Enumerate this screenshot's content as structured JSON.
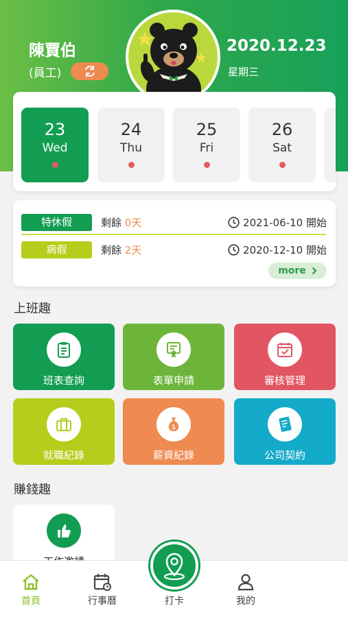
{
  "colors": {
    "brand_green": "#129d52",
    "header_gradient": [
      "#6cbf45",
      "#17a15a"
    ],
    "accent_orange": "#ef8a50",
    "dot_red": "#e35a63",
    "lime": "#b6cd1b",
    "nav_active": "#8cbf24"
  },
  "header": {
    "user_name": "陳賈伯",
    "user_role": "(員工)",
    "switch_icon": "swap-icon",
    "date": "2020.12.23",
    "weekday": "星期三",
    "avatar": "bear-mascot-avatar"
  },
  "date_strip": {
    "days": [
      {
        "num": "23",
        "dow": "Wed",
        "active": true
      },
      {
        "num": "24",
        "dow": "Thu",
        "active": false
      },
      {
        "num": "25",
        "dow": "Fri",
        "active": false
      },
      {
        "num": "26",
        "dow": "Sat",
        "active": false
      }
    ]
  },
  "leave": {
    "items": [
      {
        "type": "特休假",
        "remain_label": "剩餘",
        "remain_value": "0天",
        "date": "2021-06-10 開始",
        "color": "#129d52"
      },
      {
        "type": "病假",
        "remain_label": "剩餘",
        "remain_value": "2天",
        "date": "2020-12-10 開始",
        "color": "#b6cd1b"
      }
    ],
    "more_label": "more"
  },
  "work_section": {
    "title": "上班趣",
    "tiles": [
      {
        "label": "班表查詢",
        "icon": "clipboard-icon",
        "color": "#129d52"
      },
      {
        "label": "表單申請",
        "icon": "certificate-icon",
        "color": "#6db53a"
      },
      {
        "label": "審核管理",
        "icon": "calendar-check-icon",
        "color": "#e25562"
      },
      {
        "label": "就職紀錄",
        "icon": "briefcase-icon",
        "color": "#b6cd1b"
      },
      {
        "label": "薪資紀錄",
        "icon": "money-bag-icon",
        "color": "#ef8a50"
      },
      {
        "label": "公司契約",
        "icon": "contract-icon",
        "color": "#14aac9"
      }
    ]
  },
  "earn_section": {
    "title": "賺錢趣",
    "tiles": [
      {
        "label": "工作邀請",
        "icon": "thumbs-up-icon"
      }
    ]
  },
  "bottom_nav": {
    "items": [
      {
        "label": "首頁",
        "icon": "home-icon",
        "active": true
      },
      {
        "label": "行事曆",
        "icon": "calendar-icon",
        "active": false
      },
      {
        "label": "打卡",
        "icon": "location-pin-icon",
        "active": false
      },
      {
        "label": "我的",
        "icon": "user-icon",
        "active": false
      }
    ]
  }
}
